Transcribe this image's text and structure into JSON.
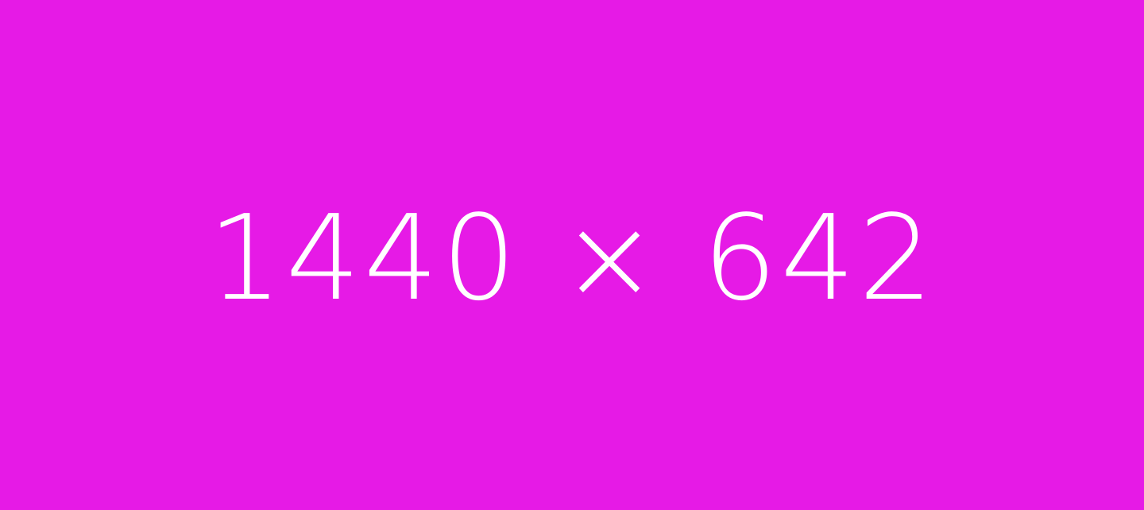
{
  "placeholder": {
    "label": "1440 × 642",
    "background_color": "#e61ae6",
    "text_color": "#ffffff"
  }
}
